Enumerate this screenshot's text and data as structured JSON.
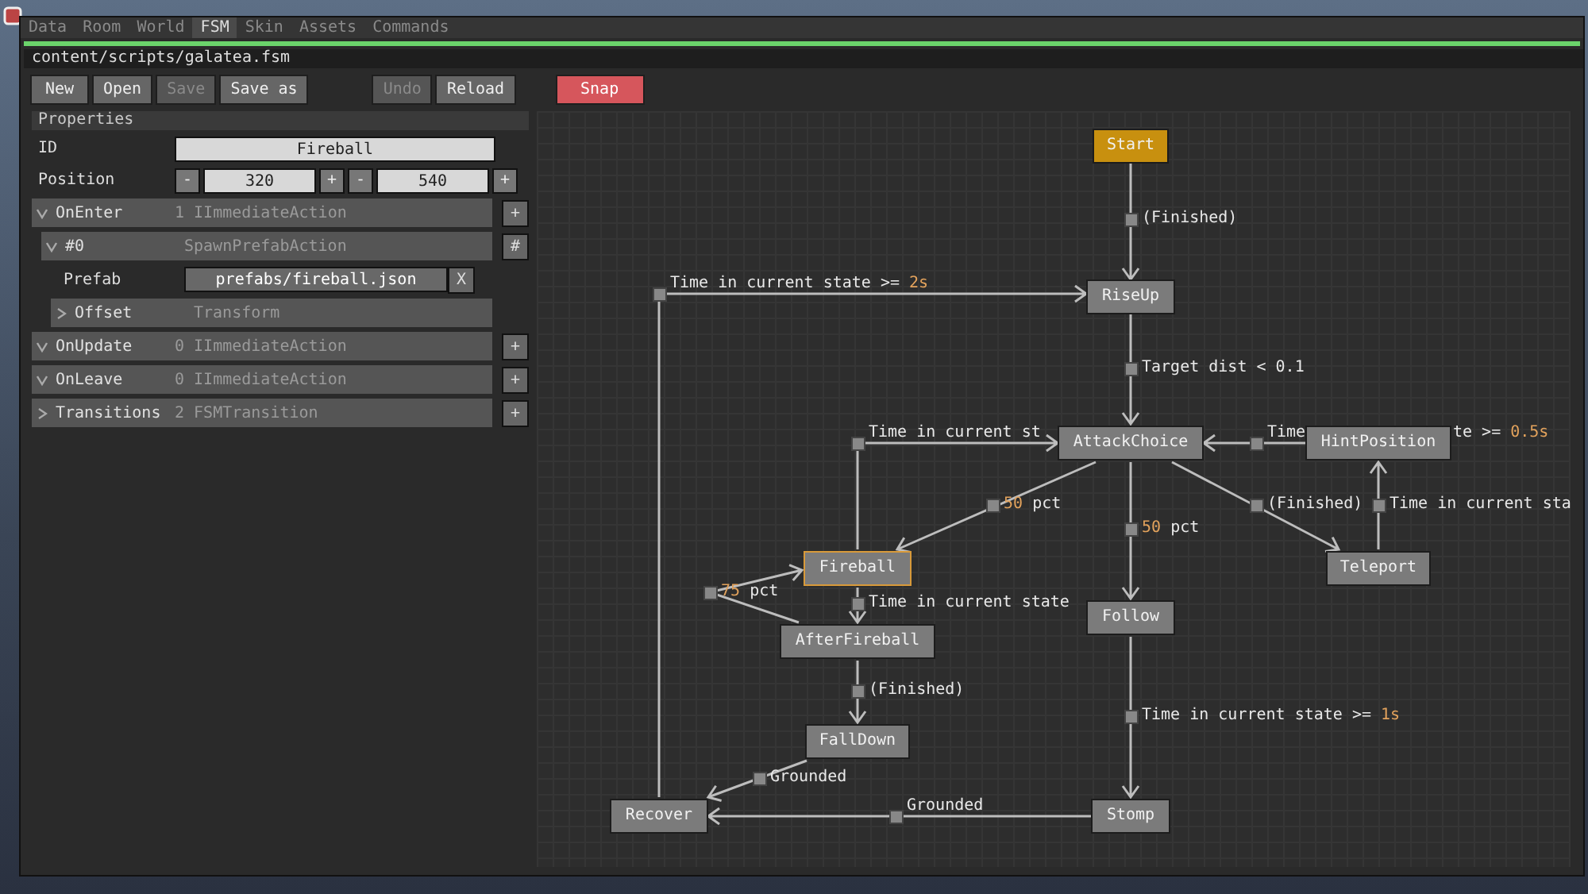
{
  "menu": [
    {
      "label": "Data",
      "selected": false
    },
    {
      "label": "Room",
      "selected": false
    },
    {
      "label": "World",
      "selected": false
    },
    {
      "label": "FSM",
      "selected": true
    },
    {
      "label": "Skin",
      "selected": false
    },
    {
      "label": "Assets",
      "selected": false
    },
    {
      "label": "Commands",
      "selected": false
    }
  ],
  "path": "content/scripts/galatea.fsm",
  "toolbar": [
    [
      {
        "label": "New",
        "disabled": false,
        "kind": "normal"
      },
      {
        "label": "Open",
        "disabled": false,
        "kind": "normal"
      },
      {
        "label": "Save",
        "disabled": true,
        "kind": "normal"
      },
      {
        "label": "Save as",
        "disabled": false,
        "kind": "normal"
      }
    ],
    [
      {
        "label": "Undo",
        "disabled": true,
        "kind": "normal"
      },
      {
        "label": "Reload",
        "disabled": false,
        "kind": "normal"
      }
    ],
    [
      {
        "label": "Snap",
        "disabled": false,
        "kind": "danger"
      }
    ]
  ],
  "properties": {
    "title": "Properties",
    "id": {
      "label": "ID",
      "value": "Fireball"
    },
    "position": {
      "label": "Position",
      "values": [
        {
          "minus": "-",
          "value": "320",
          "plus": "+"
        },
        {
          "minus": "-",
          "value": "540",
          "plus": "+"
        }
      ]
    },
    "tree": [
      {
        "kind": "node",
        "name": "OnEnter",
        "type": "1 IImmediateAction",
        "expanded": true,
        "button": "+",
        "children": [
          {
            "kind": "node",
            "name": "#0",
            "type": "SpawnPrefabAction",
            "expanded": true,
            "button": "#",
            "children": [
              {
                "kind": "field",
                "label": "Prefab",
                "value": "prefabs/fireball.json",
                "button": "X"
              },
              {
                "kind": "node",
                "name": "Offset",
                "type": "Transform",
                "expanded": false
              }
            ]
          }
        ]
      },
      {
        "kind": "node",
        "name": "OnUpdate",
        "type": "0 IImmediateAction",
        "expanded": true,
        "button": "+"
      },
      {
        "kind": "node",
        "name": "OnLeave",
        "type": "0 IImmediateAction",
        "expanded": true,
        "button": "+"
      },
      {
        "kind": "node",
        "name": "Transitions",
        "type": "2 FSMTransition",
        "expanded": false,
        "button": "+"
      }
    ]
  },
  "graph": {
    "states": [
      {
        "name": "Start",
        "kind": "entry",
        "selected": false
      },
      {
        "name": "RiseUp",
        "kind": "state",
        "selected": false
      },
      {
        "name": "AttackChoice",
        "kind": "state",
        "selected": false
      },
      {
        "name": "HintPosition",
        "kind": "state",
        "selected": false
      },
      {
        "name": "Teleport",
        "kind": "state",
        "selected": false
      },
      {
        "name": "Fireball",
        "kind": "state",
        "selected": true
      },
      {
        "name": "Follow",
        "kind": "state",
        "selected": false
      },
      {
        "name": "AfterFireball",
        "kind": "state",
        "selected": false
      },
      {
        "name": "FallDown",
        "kind": "state",
        "selected": false
      },
      {
        "name": "Recover",
        "kind": "state",
        "selected": false
      },
      {
        "name": "Stomp",
        "kind": "state",
        "selected": false
      }
    ],
    "transitions": [
      {
        "labels": [
          [
            {
              "text": "(Finished)",
              "highlight": false
            }
          ]
        ]
      },
      {
        "labels": [
          [
            {
              "text": "Time in current state >= ",
              "highlight": false
            },
            {
              "text": "2s",
              "highlight": true
            }
          ]
        ]
      },
      {
        "labels": [
          [
            {
              "text": "Target dist < 0.1",
              "highlight": false
            }
          ]
        ]
      },
      {
        "labels": [
          [
            {
              "text": "Time in current st",
              "highlight": false
            }
          ]
        ]
      },
      {
        "labels": [
          [
            {
              "text": "Time",
              "highlight": false
            }
          ],
          [
            {
              "text": "te >= ",
              "highlight": false
            },
            {
              "text": "0.5s",
              "highlight": true
            }
          ]
        ]
      },
      {
        "labels": [
          [
            {
              "text": "50",
              "highlight": true
            },
            {
              "text": " pct",
              "highlight": false
            }
          ]
        ]
      },
      {
        "labels": [
          [
            {
              "text": "50",
              "highlight": true
            },
            {
              "text": " pct",
              "highlight": false
            }
          ]
        ]
      },
      {
        "labels": [
          [
            {
              "text": "(Finished)",
              "highlight": false
            }
          ]
        ]
      },
      {
        "labels": [
          [
            {
              "text": "Time in current sta",
              "highlight": false
            }
          ]
        ]
      },
      {
        "labels": [
          [
            {
              "text": "Time in current state",
              "highlight": false
            }
          ]
        ]
      },
      {
        "labels": [
          [
            {
              "text": "75",
              "highlight": true
            },
            {
              "text": " pct",
              "highlight": false
            }
          ]
        ]
      },
      {
        "labels": [
          [
            {
              "text": "(Finished)",
              "highlight": false
            }
          ]
        ]
      },
      {
        "labels": [
          [
            {
              "text": "Grounded",
              "highlight": false
            }
          ]
        ]
      },
      {
        "labels": [
          [
            {
              "text": "Grounded",
              "highlight": false
            }
          ]
        ]
      },
      {
        "labels": [
          [
            {
              "text": "Time in current state >= ",
              "highlight": false
            },
            {
              "text": "1s",
              "highlight": true
            }
          ]
        ]
      }
    ]
  }
}
